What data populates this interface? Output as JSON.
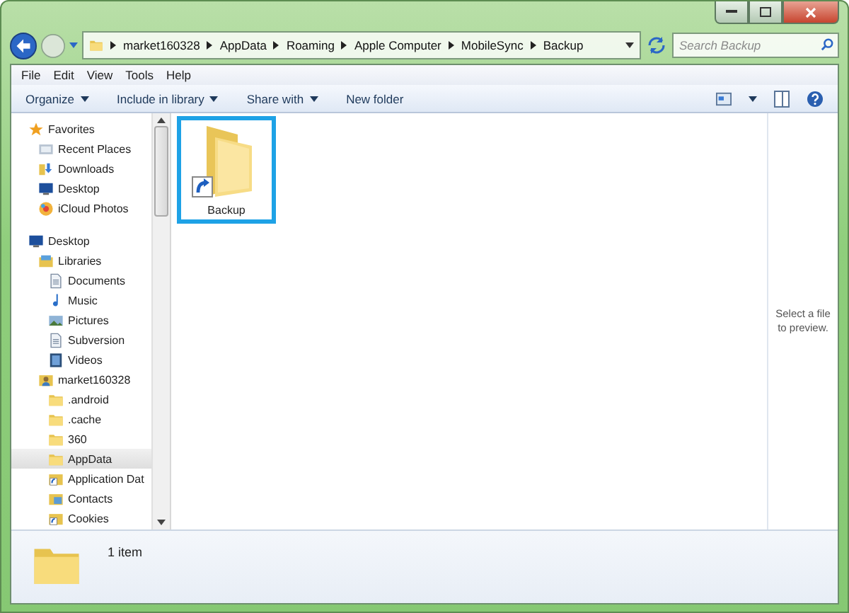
{
  "address_bar": {
    "segments": [
      "market160328",
      "AppData",
      "Roaming",
      "Apple Computer",
      "MobileSync",
      "Backup"
    ]
  },
  "search": {
    "placeholder": "Search Backup"
  },
  "menu": [
    "File",
    "Edit",
    "View",
    "Tools",
    "Help"
  ],
  "toolbar": [
    {
      "label": "Organize",
      "dropdown": true
    },
    {
      "label": "Include in library",
      "dropdown": true
    },
    {
      "label": "Share with",
      "dropdown": true
    },
    {
      "label": "New folder",
      "dropdown": false
    }
  ],
  "navigation": [
    {
      "label": "Favorites",
      "kind": "star",
      "selected": false,
      "children": [
        {
          "label": "Recent Places",
          "kind": "recent",
          "selected": false
        },
        {
          "label": "Downloads",
          "kind": "downloads",
          "selected": false
        },
        {
          "label": "Desktop",
          "kind": "desktop",
          "selected": false
        },
        {
          "label": "iCloud Photos",
          "kind": "photos",
          "selected": false
        }
      ]
    },
    {
      "label": "Desktop",
      "kind": "desktop",
      "selected": false,
      "children": [
        {
          "label": "Libraries",
          "kind": "libraries",
          "selected": false,
          "children": [
            {
              "label": "Documents",
              "kind": "document",
              "selected": false
            },
            {
              "label": "Music",
              "kind": "music",
              "selected": false
            },
            {
              "label": "Pictures",
              "kind": "pictures",
              "selected": false
            },
            {
              "label": "Subversion",
              "kind": "document",
              "selected": false
            },
            {
              "label": "Videos",
              "kind": "videos",
              "selected": false
            }
          ]
        },
        {
          "label": "market160328",
          "kind": "user",
          "selected": false,
          "children": [
            {
              "label": ".android",
              "kind": "folder",
              "selected": false
            },
            {
              "label": ".cache",
              "kind": "folder",
              "selected": false
            },
            {
              "label": "360",
              "kind": "folder",
              "selected": false
            },
            {
              "label": "AppData",
              "kind": "folder",
              "selected": true
            },
            {
              "label": "Application Dat",
              "kind": "shortcut",
              "selected": false
            },
            {
              "label": "Contacts",
              "kind": "contacts",
              "selected": false
            },
            {
              "label": "Cookies",
              "kind": "shortcut",
              "selected": false
            }
          ]
        }
      ]
    }
  ],
  "files": [
    {
      "name": "Backup",
      "kind": "shortcut-folder",
      "selected": true
    }
  ],
  "preview": {
    "message": "Select a file to preview."
  },
  "status_bar": {
    "count": "1 item"
  }
}
